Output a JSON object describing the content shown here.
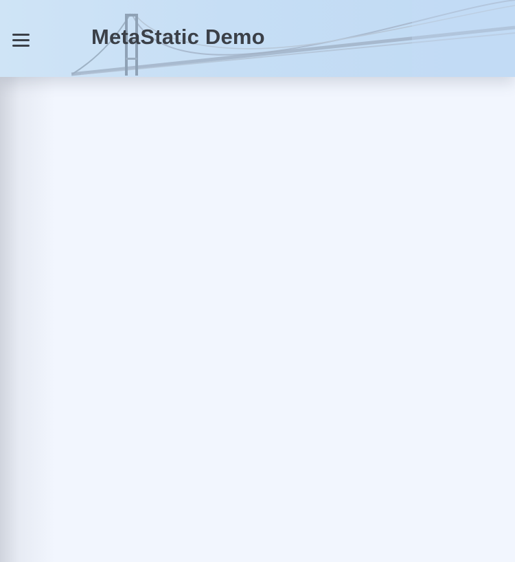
{
  "header": {
    "title": "MetaStatic Demo",
    "menu_icon": "hamburger-menu-icon",
    "background_art": "suspension-bridge-illustration"
  },
  "colors": {
    "header_background": "#c6def5",
    "page_background": "#f2f6fe",
    "title_text": "#3b4048"
  }
}
